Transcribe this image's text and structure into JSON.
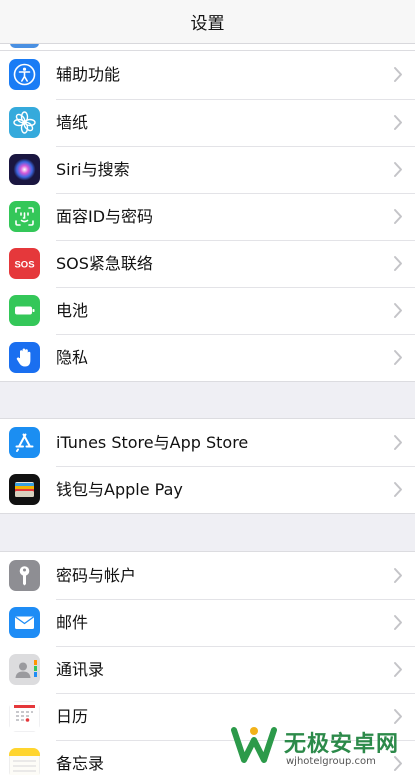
{
  "nav": {
    "title": "设置"
  },
  "groups": [
    {
      "items": [
        {
          "label": "辅助功能",
          "icon": "accessibility-icon",
          "color": "#1a7cf5"
        },
        {
          "label": "墙纸",
          "icon": "wallpaper-flower-icon",
          "color": "#35aadc"
        },
        {
          "label": "Siri与搜索",
          "icon": "siri-icon",
          "color": "#2b2250"
        },
        {
          "label": "面容ID与密码",
          "icon": "face-id-icon",
          "color": "#34c759"
        },
        {
          "label": "SOS紧急联络",
          "icon": "sos-icon",
          "color": "#e5383b",
          "badge": "SOS"
        },
        {
          "label": "电池",
          "icon": "battery-icon",
          "color": "#34c759"
        },
        {
          "label": "隐私",
          "icon": "privacy-hand-icon",
          "color": "#1a6ff0"
        }
      ]
    },
    {
      "items": [
        {
          "label": "iTunes Store与App Store",
          "icon": "app-store-icon",
          "color": "#1b8ef2"
        },
        {
          "label": "钱包与Apple Pay",
          "icon": "wallet-icon",
          "color": "#111111"
        }
      ]
    },
    {
      "items": [
        {
          "label": "密码与帐户",
          "icon": "key-icon",
          "color": "#8e8e93"
        },
        {
          "label": "邮件",
          "icon": "mail-icon",
          "color": "#1e8cf5"
        },
        {
          "label": "通讯录",
          "icon": "contacts-icon",
          "color": "#c8c8cc"
        },
        {
          "label": "日历",
          "icon": "calendar-icon",
          "color": "#ffffff"
        },
        {
          "label": "备忘录",
          "icon": "notes-icon",
          "color": "#ffd52e"
        }
      ]
    }
  ],
  "watermark": {
    "title": "无极安卓网",
    "url": "wjhotelgroup.com"
  }
}
